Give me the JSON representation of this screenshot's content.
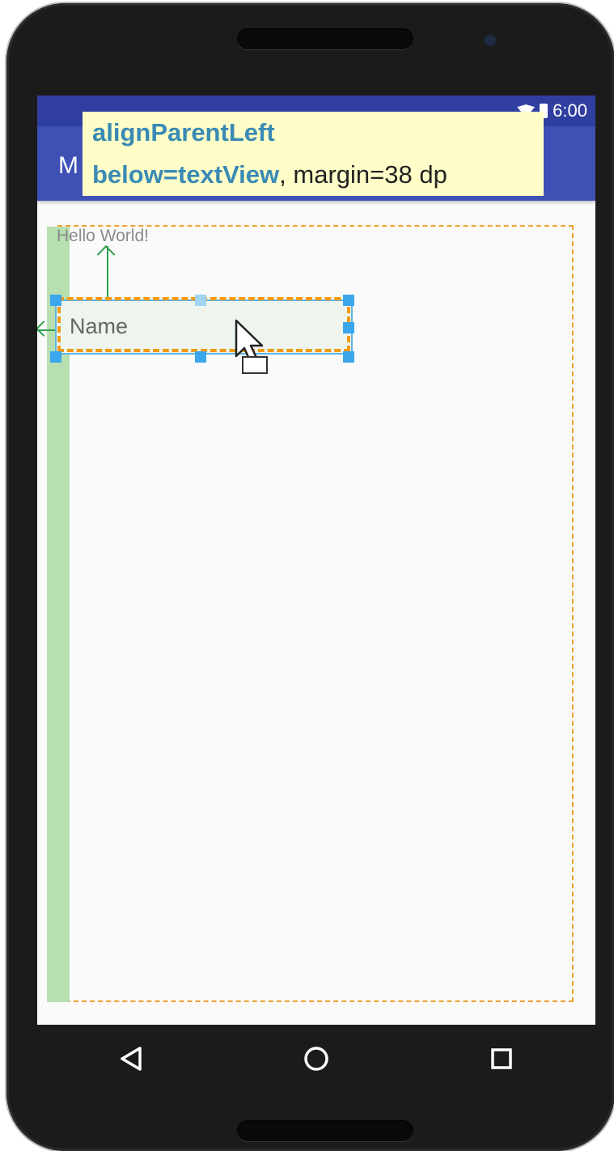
{
  "status_bar": {
    "time": "6:00"
  },
  "app_bar": {
    "title_visible": "M"
  },
  "tooltip": {
    "line1": "alignParentLeft",
    "line2_keyword": "below=textView",
    "line2_rest": ", margin=38 dp"
  },
  "content": {
    "hello_text": "Hello World!",
    "edittext_hint": "Name"
  },
  "icons": {
    "wifi": "wifi-icon",
    "battery": "battery-icon",
    "back": "back-icon",
    "home": "home-icon",
    "recents": "recents-icon",
    "cursor": "mouse-pointer-icon"
  },
  "colors": {
    "status_bar": "#303f9f",
    "app_bar": "#3f51b5",
    "tooltip_bg": "#fffec8",
    "tooltip_keyword": "#3a8ab4",
    "outline_orange": "#f39a12",
    "guide_green": "#b7dfb0",
    "handle_blue": "#3aa7ec"
  }
}
